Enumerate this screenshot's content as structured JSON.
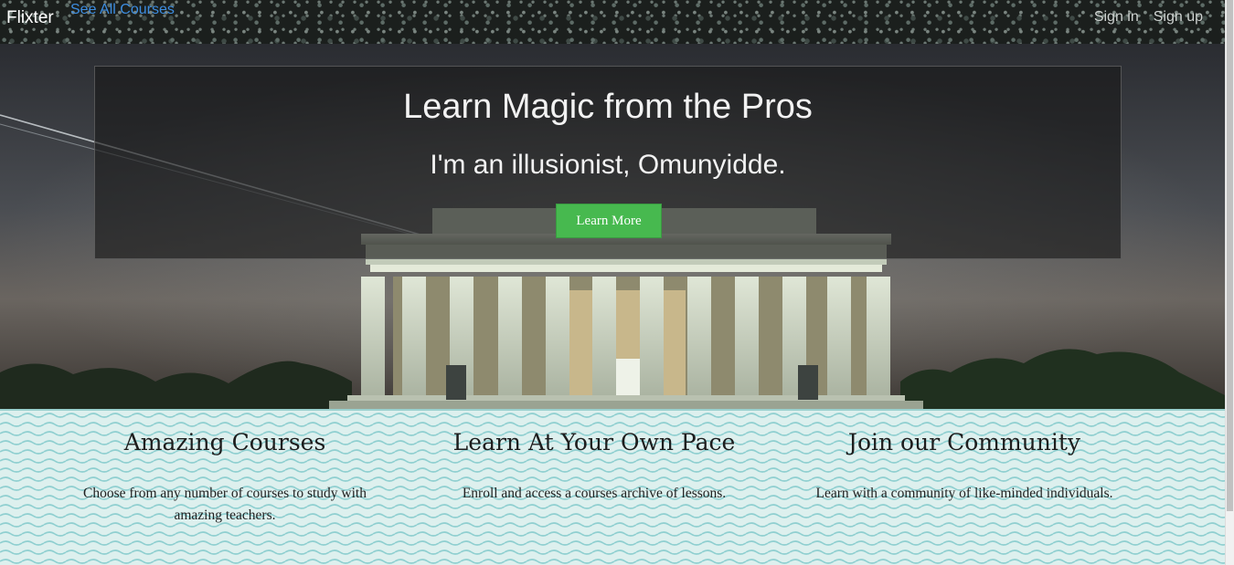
{
  "navbar": {
    "brand": "Flixter",
    "see_all": "See All Courses",
    "sign_in": "Sign in",
    "sign_up": "Sign up"
  },
  "hero": {
    "title": "Learn Magic from the Pros",
    "subtitle": "I'm an illusionist, Omunyidde.",
    "button_label": "Learn More",
    "button_color": "#47b94f"
  },
  "features": [
    {
      "heading": "Amazing Courses",
      "text": "Choose from any number of courses to study with amazing teachers."
    },
    {
      "heading": "Learn At Your Own Pace",
      "text": "Enroll and access a courses archive of lessons."
    },
    {
      "heading": "Join our Community",
      "text": "Learn with a community of like-minded individuals."
    }
  ],
  "colors": {
    "link": "#3d8de0",
    "features_bg": "#ddf0ee",
    "wave": "#8fcfd0"
  }
}
